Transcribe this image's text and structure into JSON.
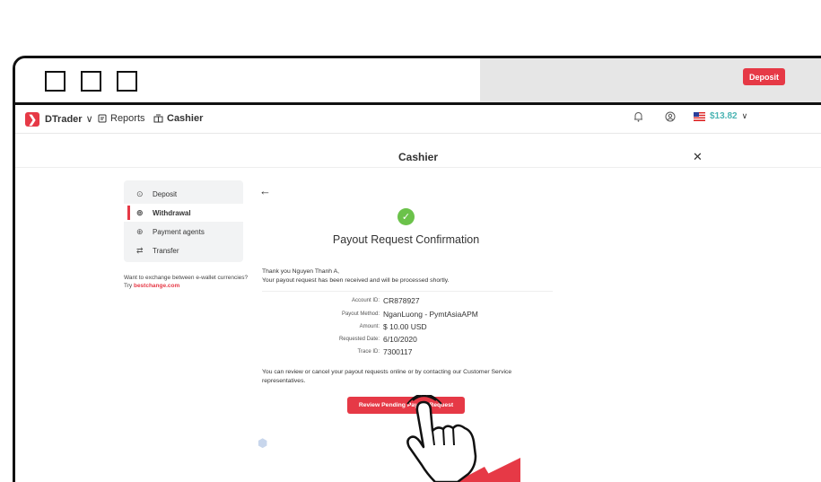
{
  "app": {
    "brand": "DTrader",
    "brand_caret": "∨",
    "nav": {
      "reports": "Reports",
      "cashier": "Cashier"
    },
    "balance": "$13.82",
    "deposit_button": "Deposit"
  },
  "cashier": {
    "title": "Cashier",
    "close": "✕"
  },
  "sidebar": {
    "items": [
      {
        "label": "Deposit",
        "icon": "deposit-icon",
        "active": false
      },
      {
        "label": "Withdrawal",
        "icon": "withdrawal-icon",
        "active": true
      },
      {
        "label": "Payment agents",
        "icon": "payment-agents-icon",
        "active": false
      },
      {
        "label": "Transfer",
        "icon": "transfer-icon",
        "active": false
      }
    ],
    "exchange_text": "Want to exchange between e-wallet currencies? Try",
    "exchange_link": "bestchange.com"
  },
  "confirmation": {
    "title": "Payout Request Confirmation",
    "thanks_line1": "Thank you Nguyen Thanh A,",
    "thanks_line2": "Your payout request has been received and will be processed shortly.",
    "details": [
      {
        "key": "Account ID:",
        "value": "CR878927"
      },
      {
        "key": "Payout Method:",
        "value": "NganLuong - PymtAsiaAPM"
      },
      {
        "key": "Amount:",
        "value": "$ 10.00 USD"
      },
      {
        "key": "Requested Date:",
        "value": "6/10/2020"
      },
      {
        "key": "Trace ID:",
        "value": "7300117"
      }
    ],
    "review_text": "You can review or cancel your payout requests online or by contacting our Customer Service representatives.",
    "review_button": "Review Pending Payout Request"
  },
  "colors": {
    "accent": "#e63946",
    "success": "#6bc24a",
    "sidebar_bg": "#f2f3f4"
  }
}
